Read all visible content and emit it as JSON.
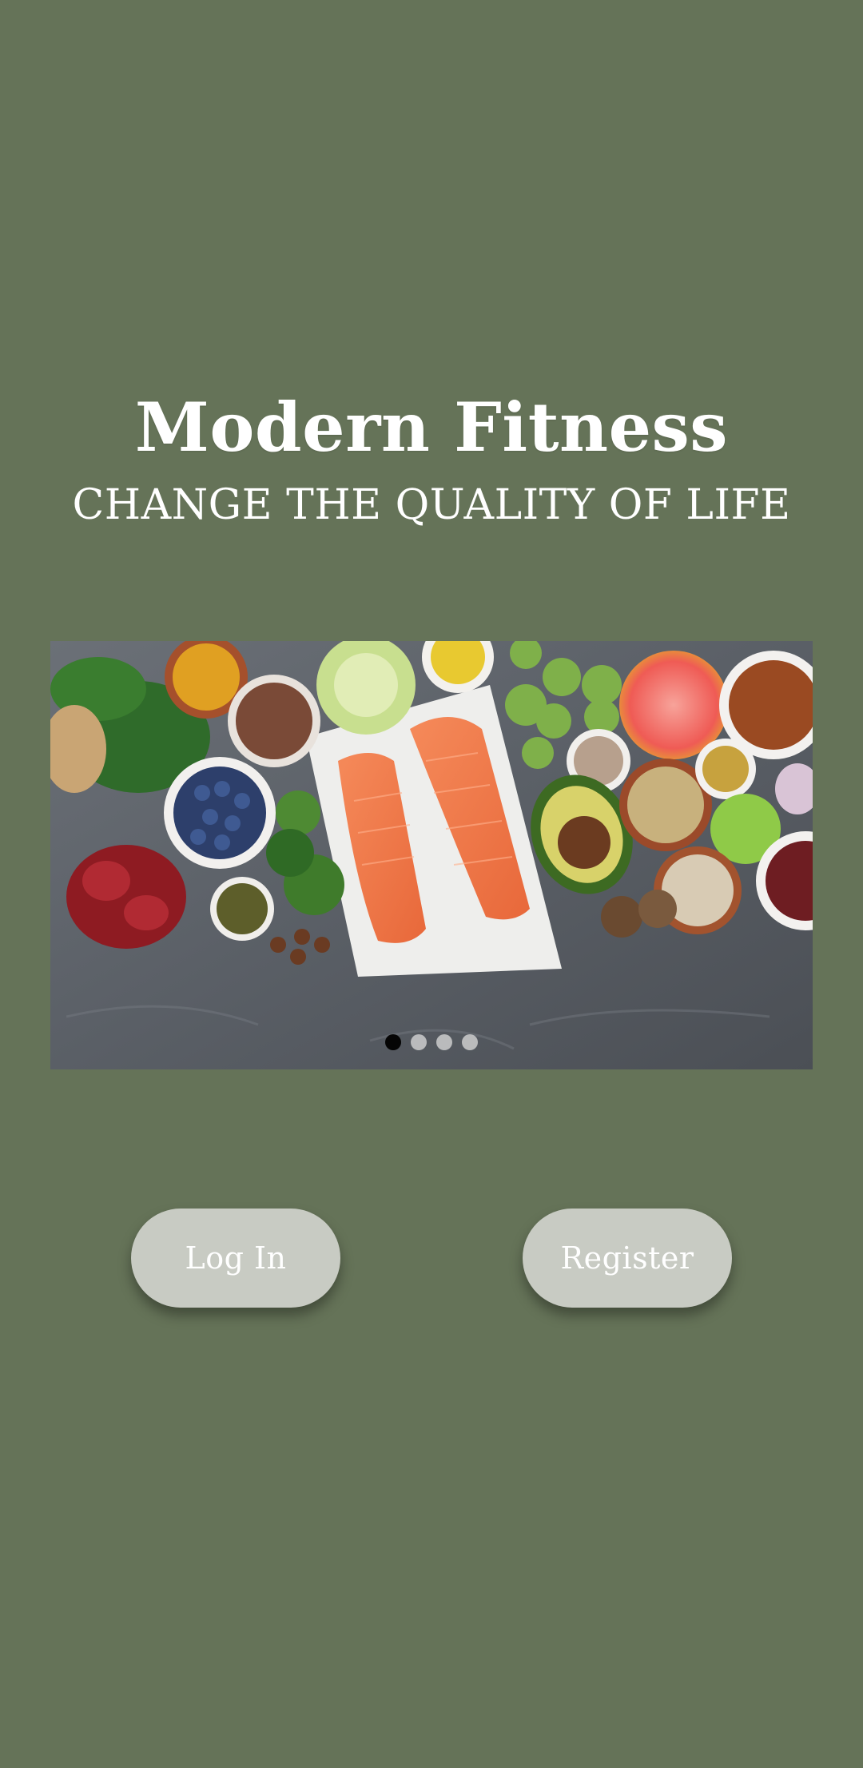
{
  "app": {
    "title": "Modern Fitness",
    "tagline": "CHANGE THE QUALITY OF LIFE"
  },
  "carousel": {
    "slides": 4,
    "active_index": 0,
    "image": "healthy-food-flatlay"
  },
  "actions": {
    "login_label": "Log In",
    "register_label": "Register"
  },
  "colors": {
    "background": "#657358",
    "button": "#c8cbc3",
    "text": "#ffffff"
  }
}
